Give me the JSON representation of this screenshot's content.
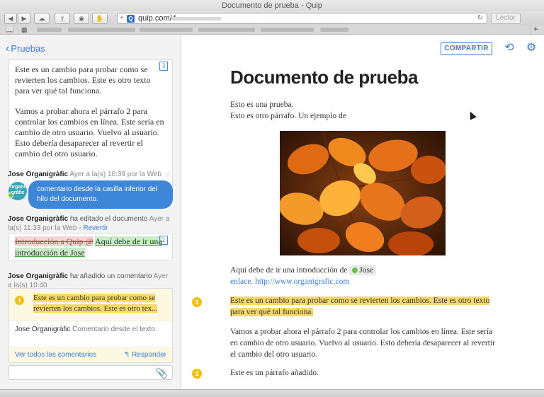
{
  "window": {
    "title": "Documento de prueba - Quip"
  },
  "browser": {
    "url": "quip.com/4",
    "reader_label": "Lector",
    "new_tab_label": "+"
  },
  "sidebar": {
    "back_label": "Pruebas",
    "card1": {
      "p1": "Este es un cambio para probar como se revierten los cambios. Este es otro texto para ver qué tal funciona.",
      "p2": "Vamos a probar ahora el párrafo 2 para controlar los cambios en línea. Este sería en cambio de otro usuario. Vuelvo al usuario. Esto debería desaparecer al revertir el cambio del otro usuario.",
      "badge": "3"
    },
    "activity1": {
      "user": "Jose Organigràfic",
      "meta": "Ayer a la(s) 10:39 por la Web",
      "bubble": "comentario desde la casilla inferior del hilo del documento.",
      "avatar": "organi gràfic"
    },
    "activity2": {
      "user": "Jose Organigràfic",
      "action": "ha editado el documento",
      "meta": "Ayer a la(s) 11:33 por la Web",
      "revert": "Revertir",
      "removed": "Introducción a Quip @",
      "added": "Aquí debe de ir una introducción de Jose",
      "badge": "2"
    },
    "activity3": {
      "user": "Jose Organigràfic",
      "action": "ha añadido un comentario",
      "meta": "Ayer a la(s) 10:40",
      "quote": "Este es un cambio para probar como se revierten los cambios. Este es otro tex...",
      "comment_user": "Jose Organigràfic",
      "comment_text": "Comentario desde el texto.",
      "view_all": "Ver todos los comentarios",
      "reply": "Responder",
      "badge": "1"
    }
  },
  "main": {
    "share_label": "COMPARTIR",
    "title": "Documento de prueba",
    "p1_line1": "Esto es una prueba.",
    "p1_line2": "Esto es otro párrafo. Un ejemplo de",
    "intro_text": "Aquí debe de ir una introducción de",
    "intro_person": "Jose",
    "link_word": "enlace.",
    "link_url": "http://www.organigrafic.com",
    "highlighted_para": "Este es un cambio para probar como se revierten los cambios. Este es otro texto para ver qué tal funciona.",
    "para2": "Vamos a probar ahora el párrafo 2 para controlar los cambios en línea. Este sería en cambio de otro usuario. Vuelvo al usuario. Esto debería desaparecer al revertir el cambio del otro usuario.",
    "para3": "Este es un párrafo añadido.",
    "badge1": "1",
    "badge2": "1"
  },
  "colors": {
    "accent": "#3a7bd5",
    "highlight": "#f7d96a",
    "comment_badge": "#f2c012",
    "presence": "#6cc04a"
  }
}
